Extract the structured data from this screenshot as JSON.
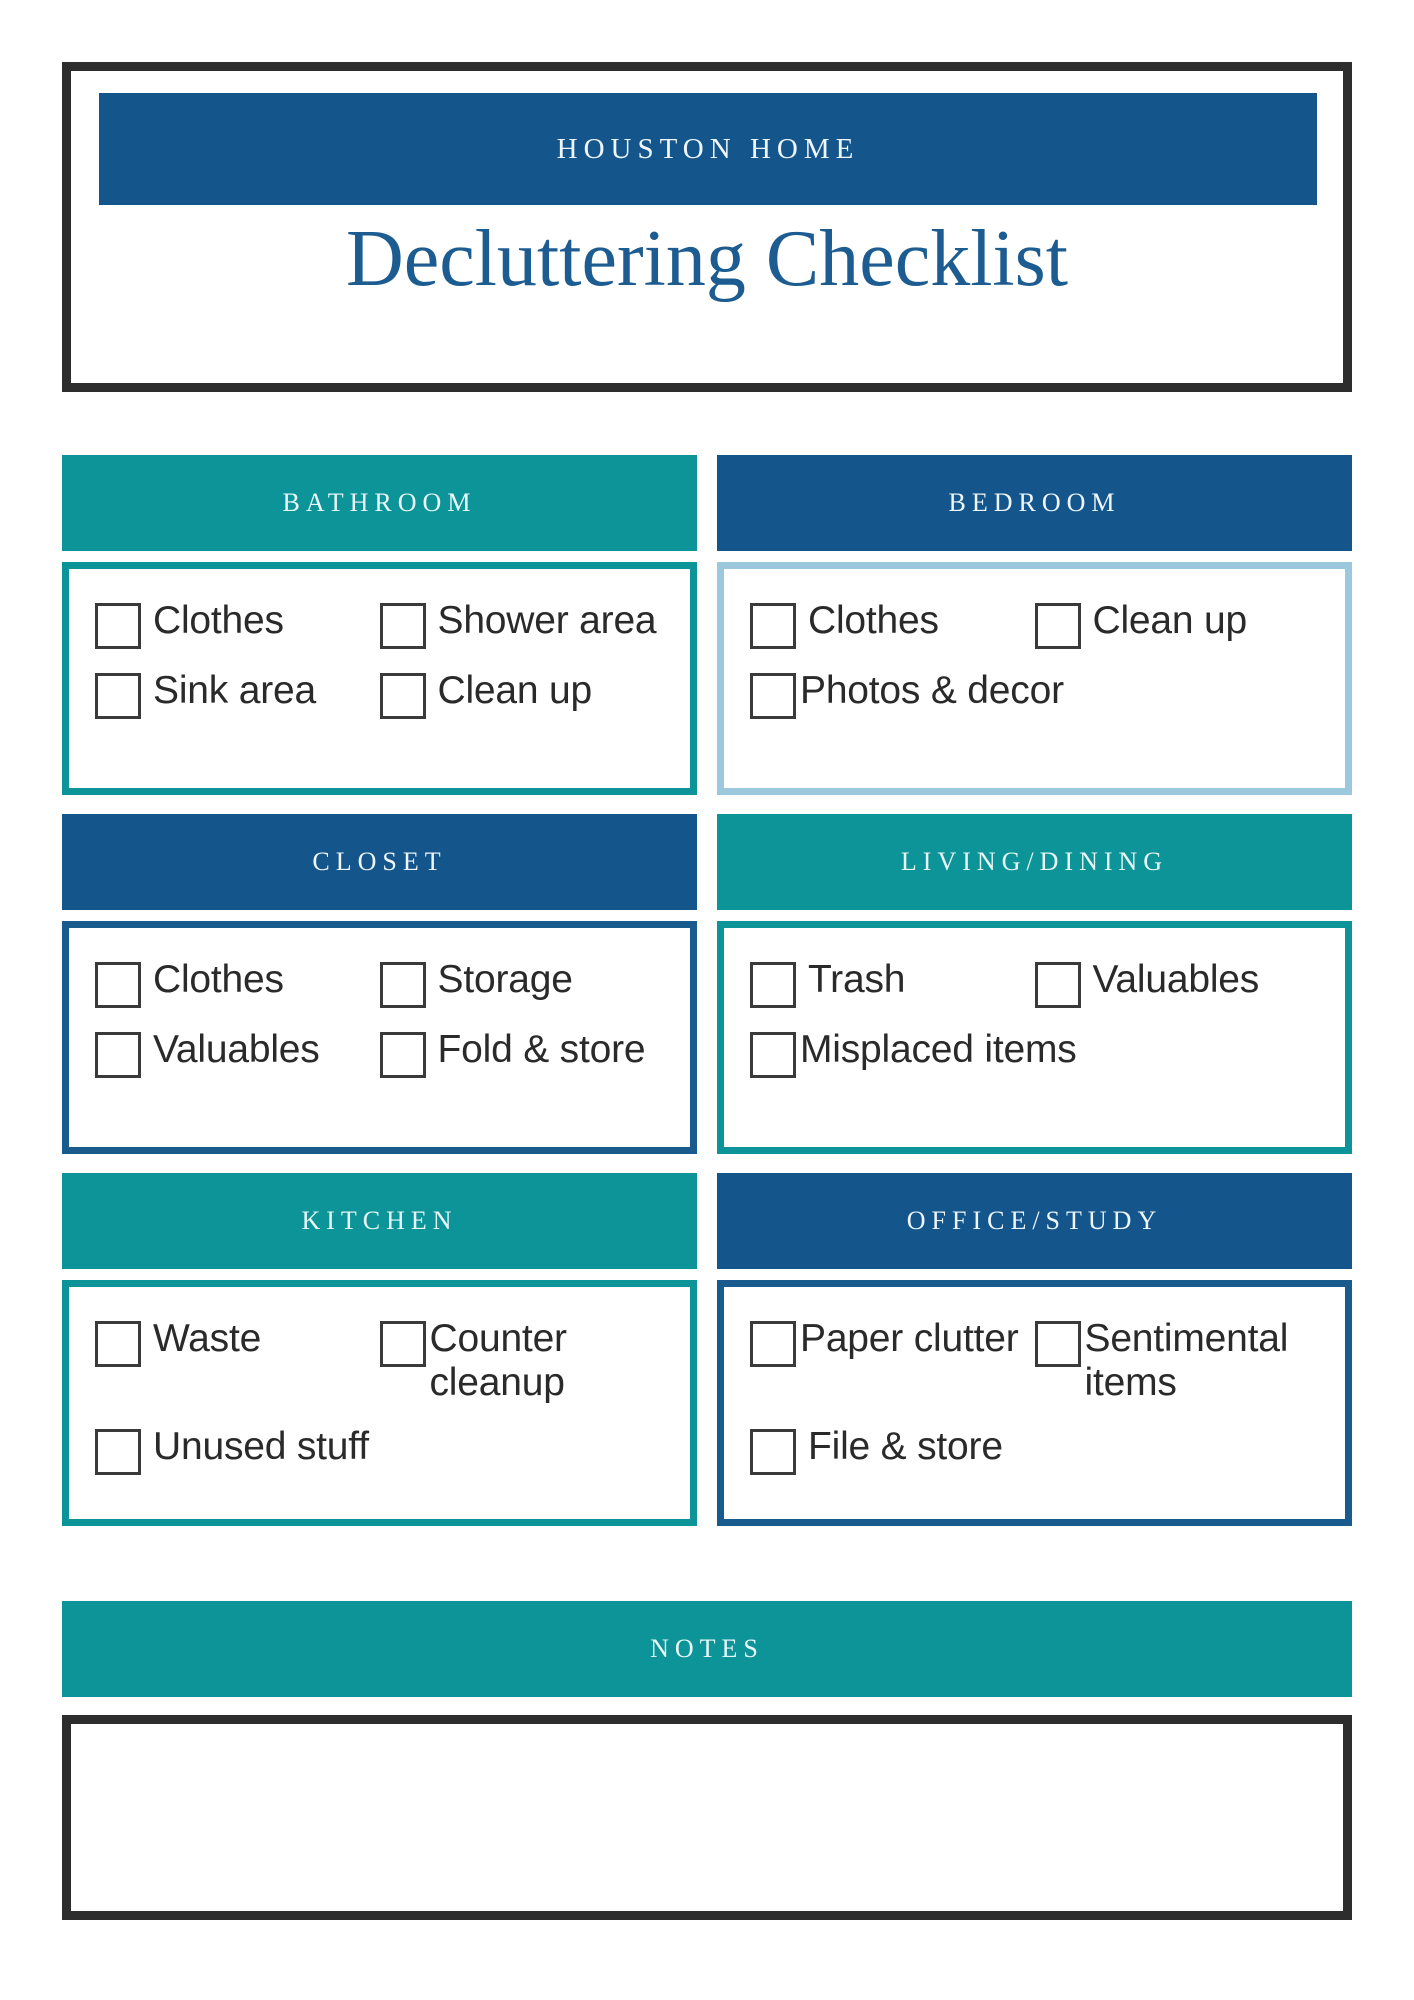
{
  "header": {
    "brand": "HOUSTON HOME",
    "title": "Decluttering Checklist"
  },
  "colors": {
    "teal": "#0d9499",
    "blue": "#14568c",
    "blue_border": "#1a5b8e",
    "light_blue_border": "#9cc8de",
    "frame_dark": "#2d2d2d",
    "title_blue": "#1c5c91",
    "header_text": "#e8f8f8",
    "label_text": "#2a2a2a"
  },
  "sections": [
    {
      "id": "bathroom",
      "title": "BATHROOM",
      "header_color": "teal",
      "body_border": "teal",
      "items": [
        {
          "label": "Clothes",
          "checked": false,
          "width": "half"
        },
        {
          "label": "Shower area",
          "checked": false,
          "width": "half"
        },
        {
          "label": "Sink area",
          "checked": false,
          "width": "half"
        },
        {
          "label": "Clean up",
          "checked": false,
          "width": "half"
        }
      ]
    },
    {
      "id": "bedroom",
      "title": "BEDROOM",
      "header_color": "blue",
      "body_border": "light_blue",
      "items": [
        {
          "label": "Clothes",
          "checked": false,
          "width": "half"
        },
        {
          "label": "Clean up",
          "checked": false,
          "width": "half"
        },
        {
          "label": "Photos & decor",
          "checked": false,
          "width": "full"
        }
      ]
    },
    {
      "id": "closet",
      "title": "CLOSET",
      "header_color": "blue",
      "body_border": "blue",
      "items": [
        {
          "label": "Clothes",
          "checked": false,
          "width": "half"
        },
        {
          "label": "Storage",
          "checked": false,
          "width": "half"
        },
        {
          "label": "Valuables",
          "checked": false,
          "width": "half"
        },
        {
          "label": "Fold & store",
          "checked": false,
          "width": "half"
        }
      ]
    },
    {
      "id": "living-dining",
      "title": "LIVING/DINING",
      "header_color": "teal",
      "body_border": "teal",
      "items": [
        {
          "label": "Trash",
          "checked": false,
          "width": "half"
        },
        {
          "label": "Valuables",
          "checked": false,
          "width": "half"
        },
        {
          "label": "Misplaced items",
          "checked": false,
          "width": "full"
        }
      ]
    },
    {
      "id": "kitchen",
      "title": "KITCHEN",
      "header_color": "teal",
      "body_border": "teal",
      "items": [
        {
          "label": "Waste",
          "checked": false,
          "width": "half"
        },
        {
          "label": "Counter cleanup",
          "checked": false,
          "width": "half"
        },
        {
          "label": "Unused stuff",
          "checked": false,
          "width": "full"
        }
      ]
    },
    {
      "id": "office-study",
      "title": "OFFICE/STUDY",
      "header_color": "blue",
      "body_border": "blue",
      "items": [
        {
          "label": "Paper clutter",
          "checked": false,
          "width": "half"
        },
        {
          "label": "Sentimental items",
          "checked": false,
          "width": "half"
        },
        {
          "label": "File & store",
          "checked": false,
          "width": "full"
        }
      ]
    }
  ],
  "notes": {
    "title": "NOTES",
    "value": ""
  }
}
